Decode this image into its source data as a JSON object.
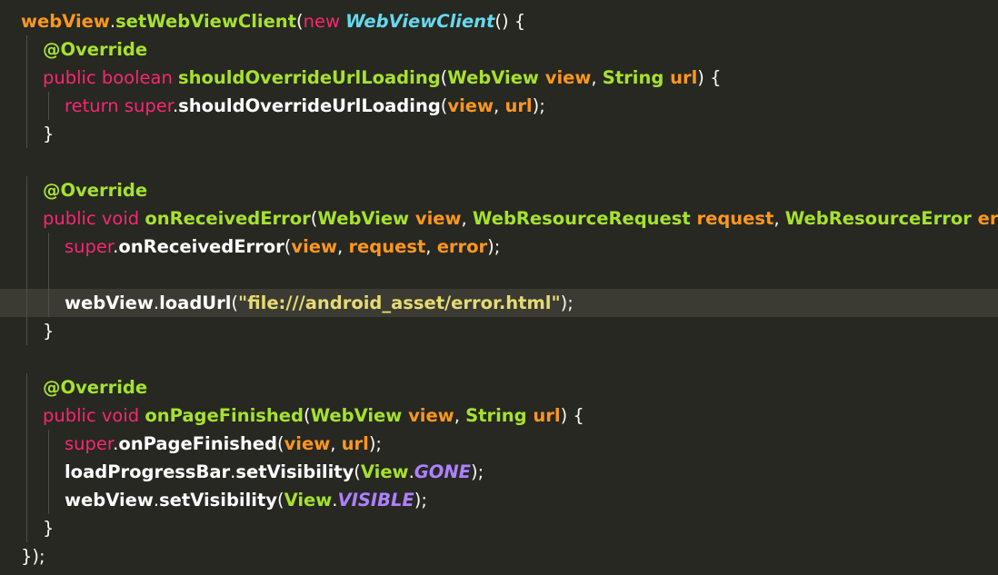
{
  "editor": {
    "lines": [
      {
        "tokens": [
          [
            "idv",
            "webView"
          ],
          [
            "pun",
            "."
          ],
          [
            "fn",
            "setWebViewClient"
          ],
          [
            "pun",
            "("
          ],
          [
            "kw",
            "new "
          ],
          [
            "ty-i",
            "WebViewClient"
          ],
          [
            "pun",
            "() {"
          ]
        ]
      },
      {
        "tokens": [
          [
            "ann",
            "@Override"
          ]
        ]
      },
      {
        "tokens": [
          [
            "kw",
            "public boolean "
          ],
          [
            "fn",
            "shouldOverrideUrlLoading"
          ],
          [
            "pun",
            "("
          ],
          [
            "ty",
            "WebView "
          ],
          [
            "var",
            "view"
          ],
          [
            "pun",
            ", "
          ],
          [
            "ty",
            "String "
          ],
          [
            "var",
            "url"
          ],
          [
            "pun",
            ") {"
          ]
        ]
      },
      {
        "tokens": [
          [
            "kw",
            "return super"
          ],
          [
            "pun",
            "."
          ],
          [
            "fld",
            "shouldOverrideUrlLoading"
          ],
          [
            "pun",
            "("
          ],
          [
            "var",
            "view"
          ],
          [
            "pun",
            ", "
          ],
          [
            "var",
            "url"
          ],
          [
            "pun",
            ");"
          ]
        ]
      },
      {
        "tokens": [
          [
            "pun",
            "}"
          ]
        ]
      },
      {
        "tokens": []
      },
      {
        "tokens": [
          [
            "ann",
            "@Override"
          ]
        ]
      },
      {
        "tokens": [
          [
            "kw",
            "public void "
          ],
          [
            "fn",
            "onReceivedError"
          ],
          [
            "pun",
            "("
          ],
          [
            "ty",
            "WebView "
          ],
          [
            "var",
            "view"
          ],
          [
            "pun",
            ", "
          ],
          [
            "ty",
            "WebResourceRequest "
          ],
          [
            "var",
            "request"
          ],
          [
            "pun",
            ", "
          ],
          [
            "ty",
            "WebResourceError "
          ],
          [
            "var",
            "error"
          ],
          [
            "pun",
            ") {"
          ]
        ]
      },
      {
        "tokens": [
          [
            "kw",
            "super"
          ],
          [
            "pun",
            "."
          ],
          [
            "fld",
            "onReceivedError"
          ],
          [
            "pun",
            "("
          ],
          [
            "var",
            "view"
          ],
          [
            "pun",
            ", "
          ],
          [
            "var",
            "request"
          ],
          [
            "pun",
            ", "
          ],
          [
            "var",
            "error"
          ],
          [
            "pun",
            ");"
          ]
        ]
      },
      {
        "tokens": []
      },
      {
        "tokens": [
          [
            "fld",
            "webView"
          ],
          [
            "pun",
            "."
          ],
          [
            "fld",
            "loadUrl"
          ],
          [
            "pun",
            "("
          ],
          [
            "str",
            "\"file:///android_asset/error.html\""
          ],
          [
            "pun",
            ");"
          ]
        ]
      },
      {
        "tokens": [
          [
            "pun",
            "}"
          ]
        ]
      },
      {
        "tokens": []
      },
      {
        "tokens": [
          [
            "ann",
            "@Override"
          ]
        ]
      },
      {
        "tokens": [
          [
            "kw",
            "public void "
          ],
          [
            "fn",
            "onPageFinished"
          ],
          [
            "pun",
            "("
          ],
          [
            "ty",
            "WebView "
          ],
          [
            "var",
            "view"
          ],
          [
            "pun",
            ", "
          ],
          [
            "ty",
            "String "
          ],
          [
            "var",
            "url"
          ],
          [
            "pun",
            ") {"
          ]
        ]
      },
      {
        "tokens": [
          [
            "kw",
            "super"
          ],
          [
            "pun",
            "."
          ],
          [
            "fld",
            "onPageFinished"
          ],
          [
            "pun",
            "("
          ],
          [
            "var",
            "view"
          ],
          [
            "pun",
            ", "
          ],
          [
            "var",
            "url"
          ],
          [
            "pun",
            ");"
          ]
        ]
      },
      {
        "tokens": [
          [
            "fld",
            "loadProgressBar"
          ],
          [
            "pun",
            "."
          ],
          [
            "fld",
            "setVisibility"
          ],
          [
            "pun",
            "("
          ],
          [
            "ty",
            "View"
          ],
          [
            "pun",
            "."
          ],
          [
            "const",
            "GONE"
          ],
          [
            "pun",
            ");"
          ]
        ]
      },
      {
        "tokens": [
          [
            "fld",
            "webView"
          ],
          [
            "pun",
            "."
          ],
          [
            "fld",
            "setVisibility"
          ],
          [
            "pun",
            "("
          ],
          [
            "ty",
            "View"
          ],
          [
            "pun",
            "."
          ],
          [
            "const",
            "VISIBLE"
          ],
          [
            "pun",
            ");"
          ]
        ]
      },
      {
        "tokens": [
          [
            "pun",
            "}"
          ]
        ]
      },
      {
        "tokens": [
          [
            "pun",
            "});"
          ]
        ]
      }
    ],
    "current_line": 10,
    "colors": {
      "background": "#272822",
      "current_line": "#3b3b33",
      "keyword": "#f92672",
      "function": "#a6e22e",
      "variable": "#fd971f",
      "string": "#e6db74",
      "constant": "#ae81ff",
      "type_italic": "#66d9ef"
    }
  }
}
